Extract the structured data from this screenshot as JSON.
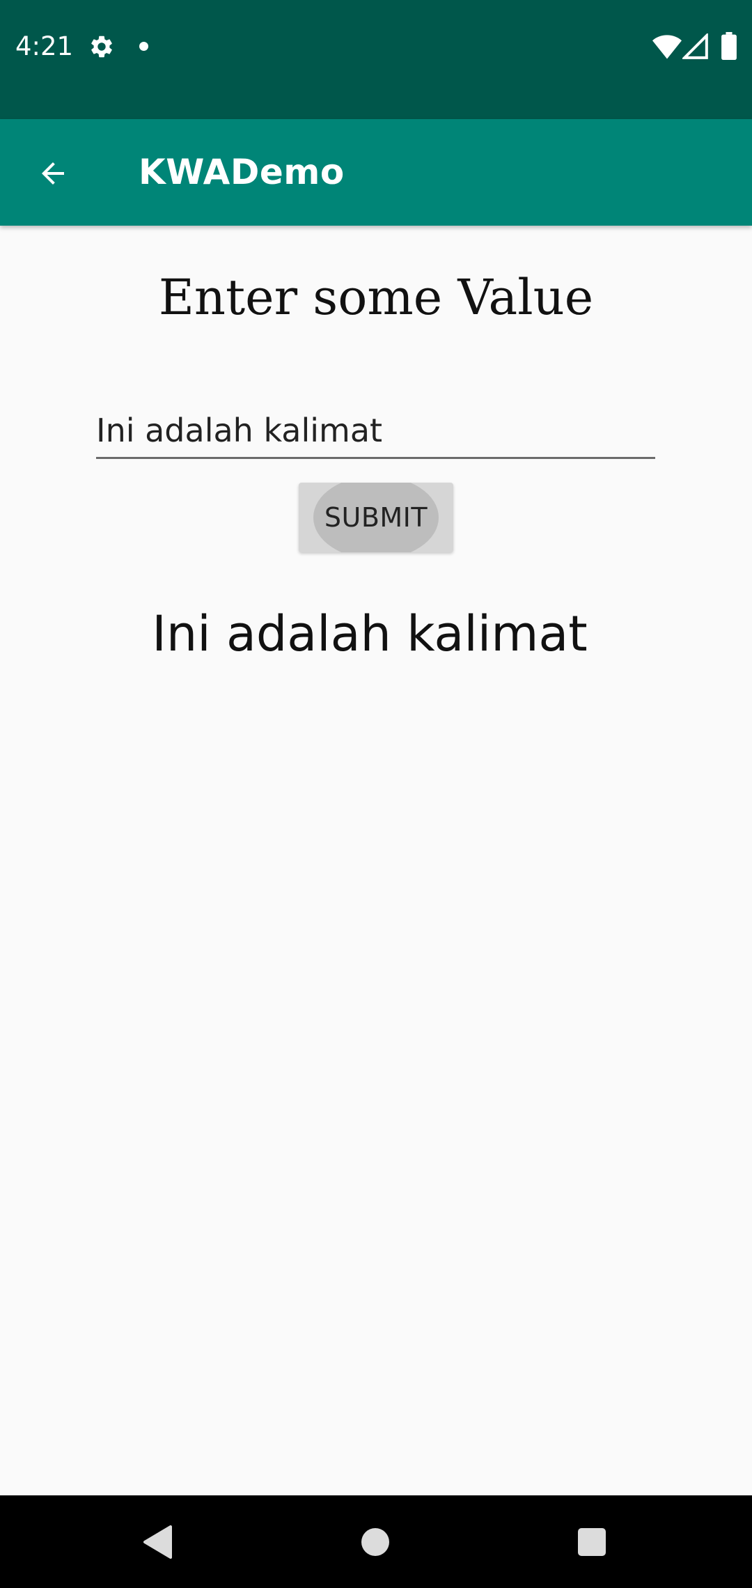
{
  "status_bar": {
    "time": "4:21",
    "icons": [
      "gear-icon",
      "notification-dot-icon",
      "wifi-icon",
      "signal-icon",
      "battery-icon"
    ]
  },
  "app_bar": {
    "title": "KWADemo",
    "back_icon": "arrow-back-icon",
    "color": "#008577"
  },
  "main": {
    "heading": "Enter some Value",
    "input": {
      "value": "Ini adalah kalimat",
      "placeholder": ""
    },
    "submit_label": "SUBMIT",
    "result": "Ini adalah kalimat"
  },
  "nav_bar": {
    "icons": [
      "nav-back-icon",
      "nav-home-icon",
      "nav-recents-icon"
    ]
  },
  "colors": {
    "status_bar": "#00574b",
    "app_bar": "#008577",
    "background": "#fafafa"
  }
}
